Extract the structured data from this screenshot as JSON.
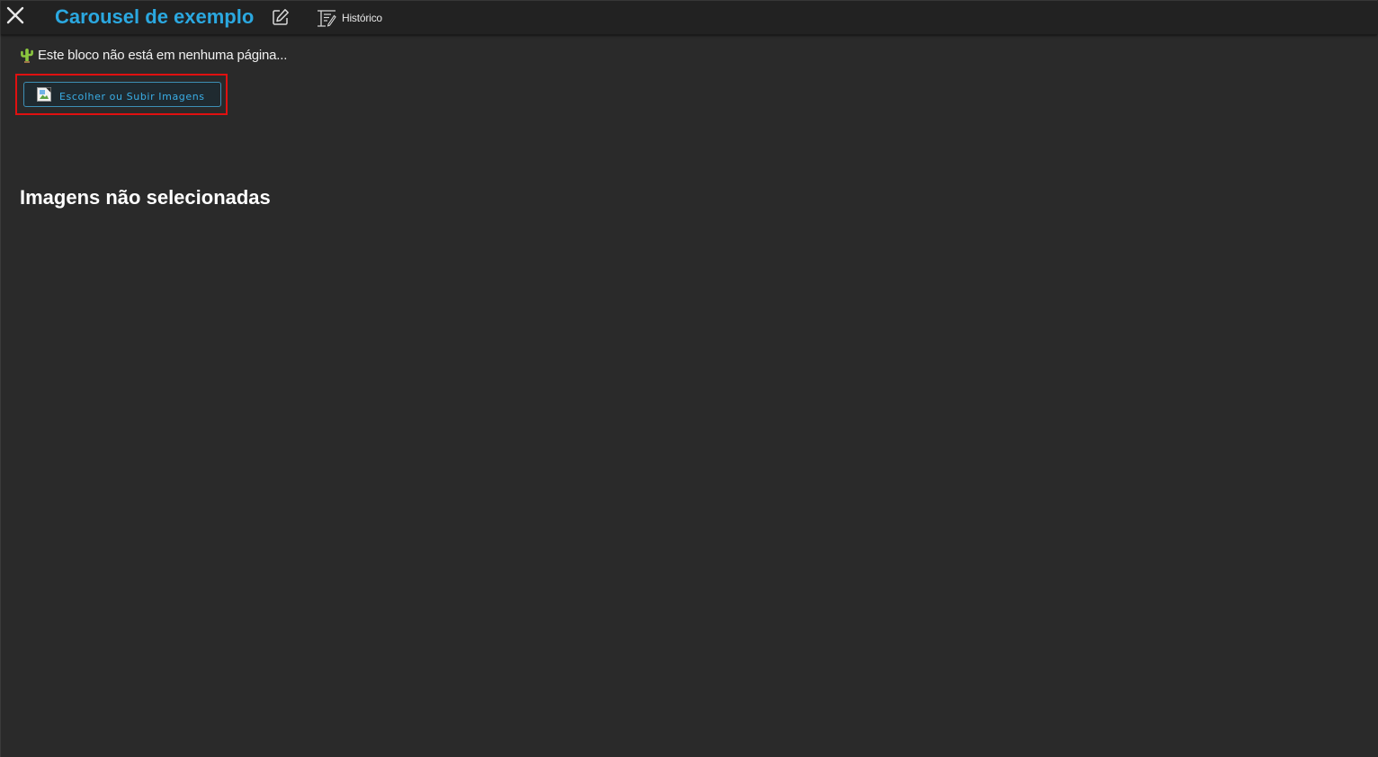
{
  "header": {
    "title": "Carousel de exemplo",
    "history_label": "Histórico",
    "icons": [
      "close-icon",
      "edit-icon",
      "history-icon"
    ]
  },
  "notice": {
    "icon": "cactus-icon",
    "text": "Este bloco não está em nenhuma página..."
  },
  "upload": {
    "button_label": "Escolher ou Subir Imagens",
    "icon": "broken-image-icon"
  },
  "empty_state": {
    "heading": "Imagens não selecionadas"
  },
  "colors": {
    "background": "#2a2a2a",
    "topbar": "#222222",
    "accent": "#2ba8e0",
    "highlight": "#e01010"
  }
}
